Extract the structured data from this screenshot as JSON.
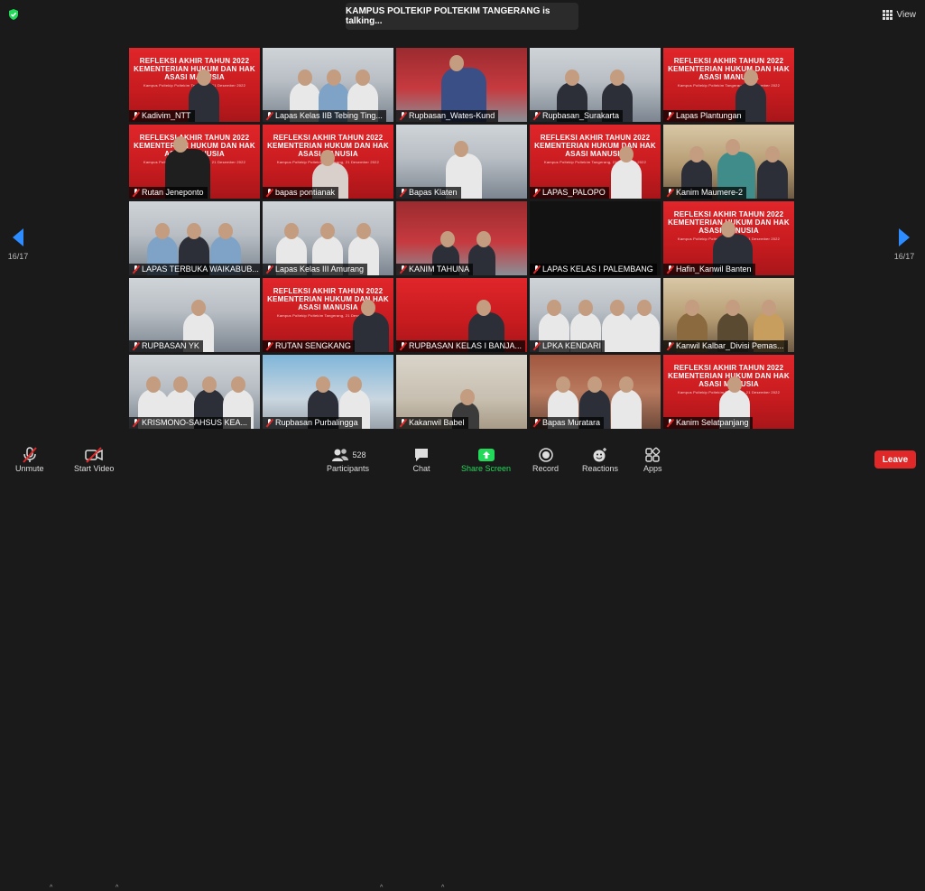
{
  "talking_banner": "KAMPUS POLTEKIP POLTEKIM TANGERANG is talking...",
  "view_label": "View",
  "page_left": "16/17",
  "page_right": "16/17",
  "banner_lines": [
    "REFLEKSI AKHIR TAHUN 2022",
    "KEMENTERIAN HUKUM DAN HAK ASASI MANUSIA"
  ],
  "banner_sub": "Kampus Poltekip Poltekim Tangerang, 21 Desember 2022",
  "tiles": [
    {
      "name": "Kadivim_NTT"
    },
    {
      "name": "Lapas Kelas IIB Tebing Ting..."
    },
    {
      "name": "Rupbasan_Wates-Kund"
    },
    {
      "name": "Rupbasan_Surakarta"
    },
    {
      "name": "Lapas Plantungan"
    },
    {
      "name": "Rutan Jeneponto"
    },
    {
      "name": "bapas pontianak"
    },
    {
      "name": "Bapas Klaten"
    },
    {
      "name": "LAPAS_PALOPO"
    },
    {
      "name": "Kanim Maumere-2"
    },
    {
      "name": "LAPAS TERBUKA WAIKABUB..."
    },
    {
      "name": "Lapas Kelas III Amurang"
    },
    {
      "name": "KANIM TAHUNA"
    },
    {
      "name": "LAPAS KELAS I PALEMBANG"
    },
    {
      "name": "Hafin_Kanwil Banten"
    },
    {
      "name": "RUPBASAN YK"
    },
    {
      "name": "RUTAN SENGKANG"
    },
    {
      "name": "RUPBASAN KELAS I BANJA..."
    },
    {
      "name": "LPKA KENDARI"
    },
    {
      "name": "Kanwil Kalbar_Divisi Pemas..."
    },
    {
      "name": "KRISMONO-SAHSUS KEA..."
    },
    {
      "name": "Rupbasan Purbalingga"
    },
    {
      "name": "Kakanwil Babel"
    },
    {
      "name": "Bapas Muratara"
    },
    {
      "name": "Kanim Selatpanjang"
    }
  ],
  "toolbar": {
    "unmute": "Unmute",
    "start_video": "Start Video",
    "participants": "Participants",
    "participants_count": "528",
    "chat": "Chat",
    "share_screen": "Share Screen",
    "record": "Record",
    "reactions": "Reactions",
    "apps": "Apps",
    "leave": "Leave"
  },
  "colors": {
    "accent": "#2d8cff",
    "share_green": "#23d959",
    "leave_red": "#e02828",
    "muted_red": "#e02828"
  }
}
